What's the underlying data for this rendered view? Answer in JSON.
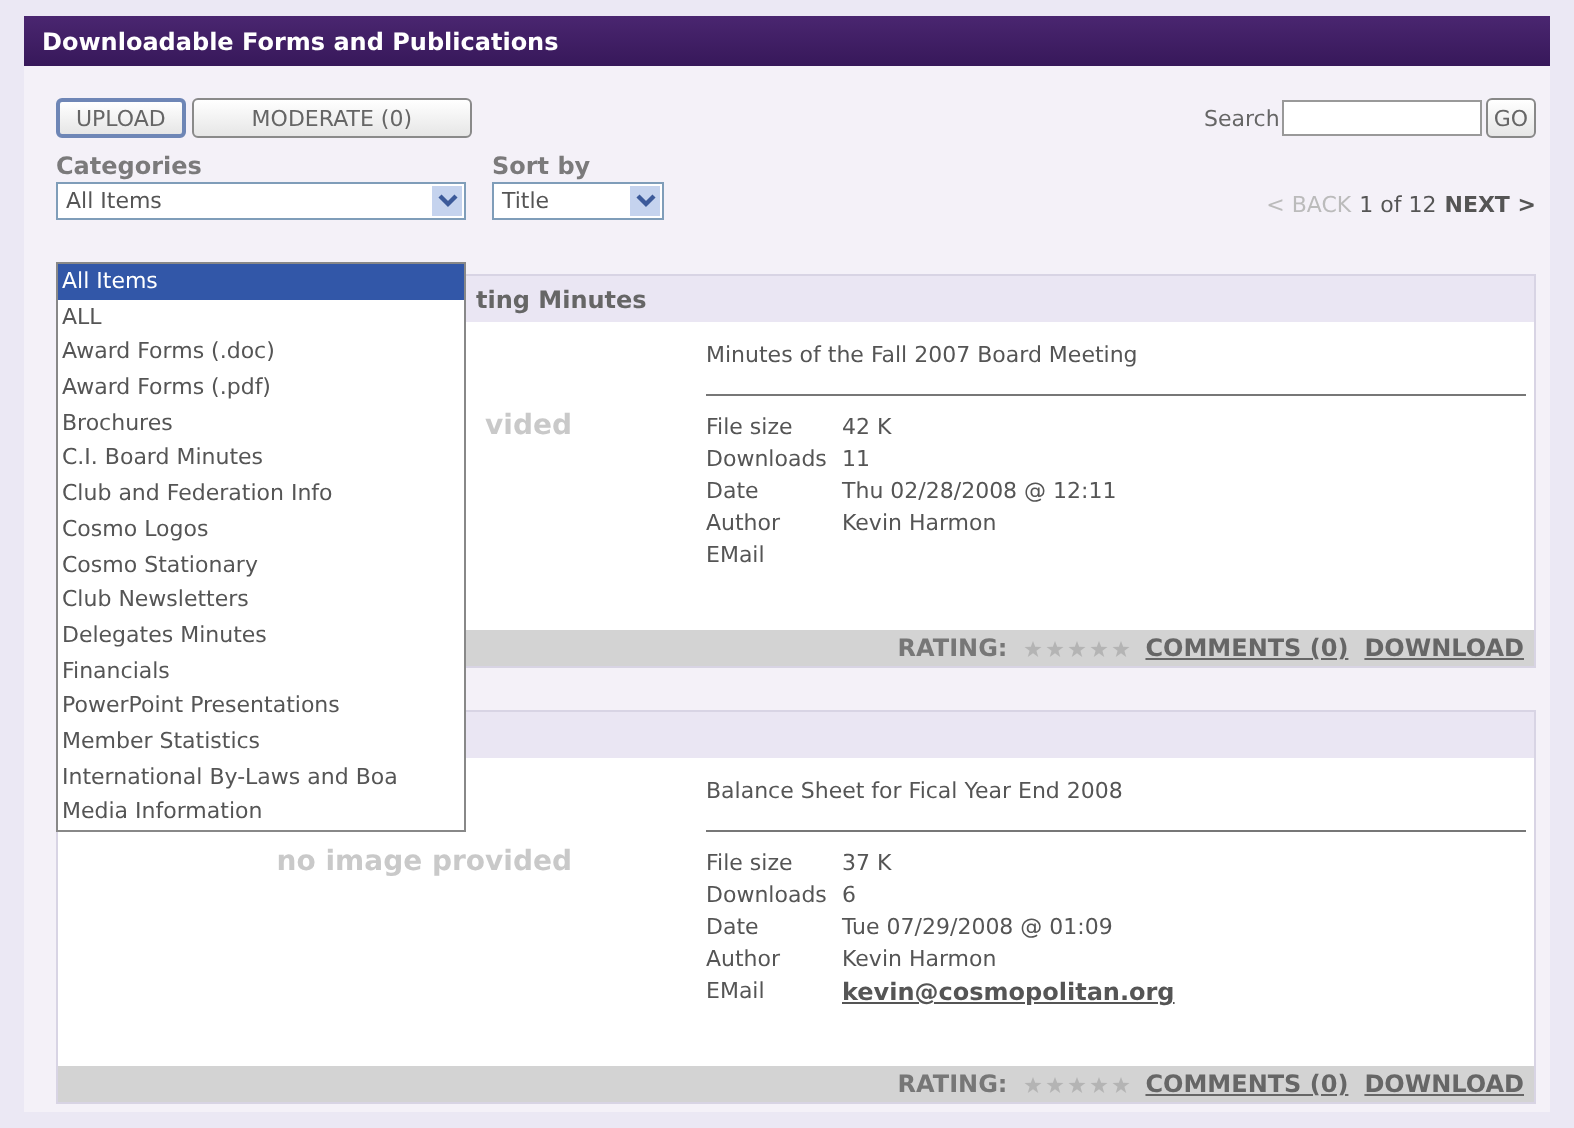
{
  "panel": {
    "title": "Downloadable Forms and Publications"
  },
  "toolbar": {
    "buttons": [
      "UPLOAD",
      "MODERATE (0)"
    ],
    "search_label": "Search",
    "search_button": "GO"
  },
  "filters": {
    "categories_label": "Categories",
    "categories_value": "All Items",
    "sort_label": "Sort by",
    "sort_value": "Title"
  },
  "categories_dropdown": {
    "expanded": true,
    "options": [
      {
        "label": "All Items",
        "selected": true
      },
      {
        "label": "ALL",
        "selected": false
      },
      {
        "label": "Award Forms (.doc)",
        "selected": false
      },
      {
        "label": "Award Forms (.pdf)",
        "selected": false
      },
      {
        "label": "Brochures",
        "selected": false
      },
      {
        "label": "C.I. Board Minutes",
        "selected": false
      },
      {
        "label": "Club and Federation Info",
        "selected": false
      },
      {
        "label": "Cosmo Logos",
        "selected": false
      },
      {
        "label": "Cosmo Stationary",
        "selected": false
      },
      {
        "label": "Club Newsletters",
        "selected": false
      },
      {
        "label": "Delegates Minutes",
        "selected": false
      },
      {
        "label": "Financials",
        "selected": false
      },
      {
        "label": "PowerPoint Presentations",
        "selected": false
      },
      {
        "label": "Member Statistics",
        "selected": false
      },
      {
        "label": "International By-Laws and Boa",
        "selected": false
      },
      {
        "label": "Media Information",
        "selected": false
      }
    ]
  },
  "pager": {
    "back": "< BACK",
    "position": "1 of 12",
    "next": "NEXT >"
  },
  "items": [
    {
      "header": "ting Minutes",
      "no_image": "vided",
      "title": "Minutes of the Fall 2007 Board Meeting",
      "fields": [
        {
          "label": "File size",
          "value": "42 K"
        },
        {
          "label": "Downloads",
          "value": "11"
        },
        {
          "label": "Date",
          "value": "Thu 02/28/2008 @ 12:11"
        },
        {
          "label": "Author",
          "value": "Kevin Harmon"
        },
        {
          "label": "EMail"
        }
      ],
      "rating_label": "RATING:",
      "stars": 0,
      "comments": "COMMENTS (0)",
      "download": "DOWNLOAD"
    },
    {
      "no_image": "no image provided",
      "title": "Balance Sheet for Fical Year End 2008",
      "fields": [
        {
          "label": "File size",
          "value": "37 K"
        },
        {
          "label": "Downloads",
          "value": "6"
        },
        {
          "label": "Date",
          "value": "Tue 07/29/2008 @ 01:09"
        },
        {
          "label": "Author",
          "value": "Kevin Harmon"
        },
        {
          "label": "EMail",
          "value": "kevin@cosmopolitan.org",
          "kind": "link"
        }
      ],
      "rating_label": "RATING:",
      "stars": 0,
      "comments": "COMMENTS (0)",
      "download": "DOWNLOAD"
    }
  ]
}
